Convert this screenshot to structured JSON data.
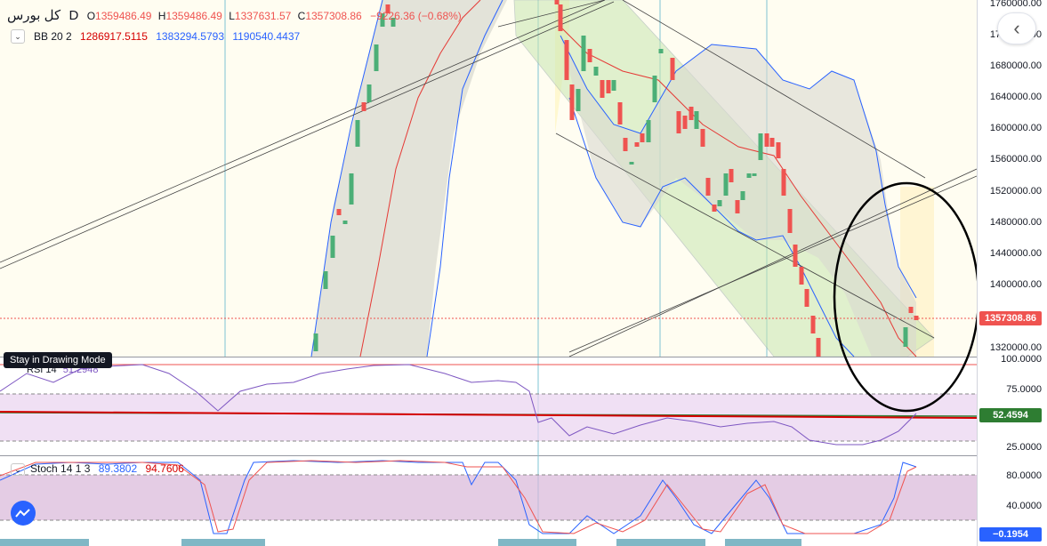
{
  "symbol": {
    "name": "کل بورس",
    "interval": "D"
  },
  "ohlc": {
    "o_label": "O",
    "o": "1359486.49",
    "h_label": "H",
    "h": "1359486.49",
    "l_label": "L",
    "l": "1337631.57",
    "c_label": "C",
    "c": "1357308.86",
    "change": "−9226.36 (−0.68%)"
  },
  "bb": {
    "label": "BB 20 2",
    "upper": "1286917.5115",
    "basis": "1383294.5793",
    "lower": "1190540.4437"
  },
  "rsi": {
    "label": "RSI 14",
    "value": "51.2948"
  },
  "stoch": {
    "label": "Stoch 14 1 3",
    "k": "89.3802",
    "d": "94.7606"
  },
  "price_axis": [
    "1760000.00",
    "1720000.00",
    "1680000.00",
    "1640000.00",
    "1600000.00",
    "1560000.00",
    "1520000.00",
    "1480000.00",
    "1440000.00",
    "1400000.00",
    "1320000.00"
  ],
  "rsi_axis": [
    "100.0000",
    "75.0000",
    "25.0000"
  ],
  "stoch_axis": [
    "80.0000",
    "40.0000"
  ],
  "badges": {
    "last_price": "1357308.86",
    "rsi_value": "52.4594",
    "stoch_value": "−0.1954"
  },
  "tooltip": "Stay in Drawing Mode",
  "icons": {
    "collapse": "chevron-left-icon",
    "visibility": "eye-icon",
    "logo": "tradingview-logo-icon"
  },
  "colors": {
    "up": "#4caf77",
    "down": "#ef5350",
    "bb_upper": "#2962ff",
    "bb_basis": "#e53935",
    "rsi": "#7e57c2",
    "last_price": "#ef5350",
    "rsi_badge": "#2e7d32",
    "stoch_badge": "#2962ff"
  }
}
